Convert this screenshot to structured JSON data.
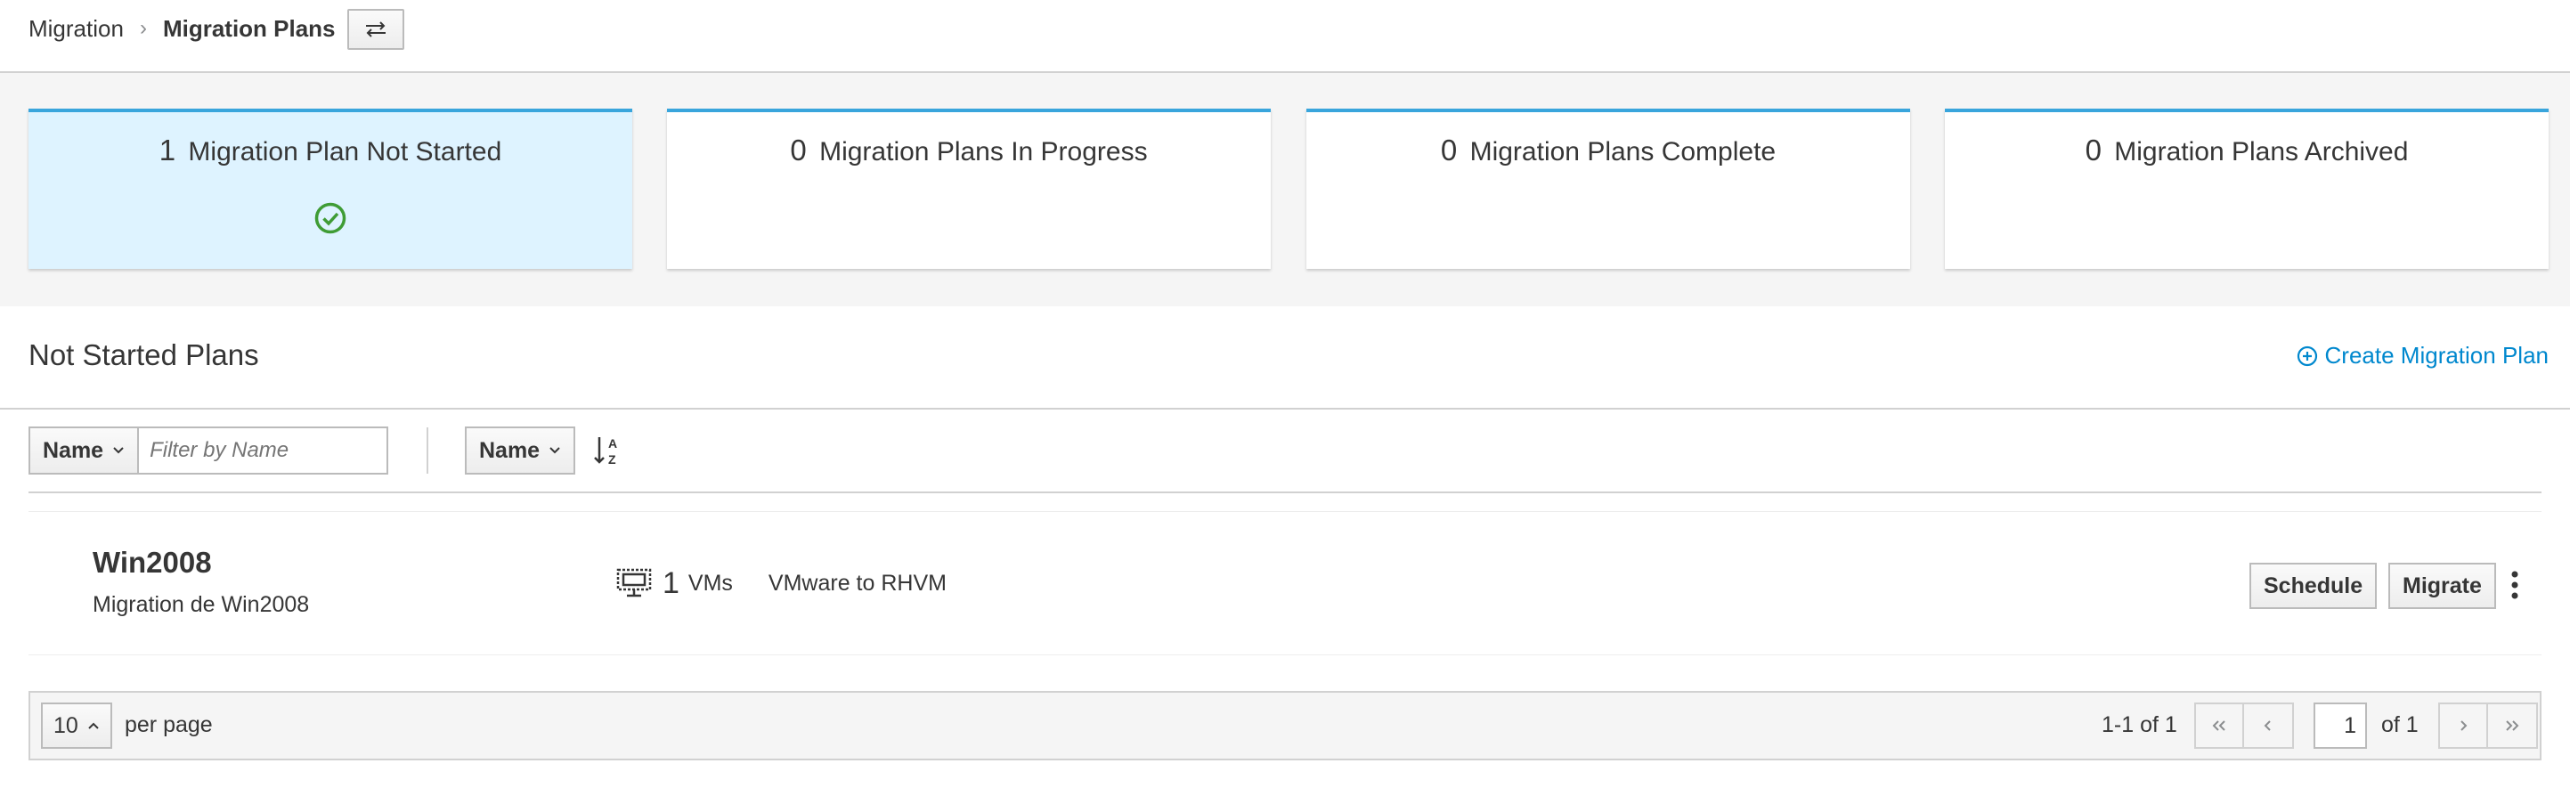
{
  "breadcrumb": {
    "parent": "Migration",
    "separator": "›",
    "current": "Migration Plans"
  },
  "cards": [
    {
      "count": "1",
      "label": "Migration Plan Not Started",
      "active": true,
      "icon": "check-circle-icon"
    },
    {
      "count": "0",
      "label": "Migration Plans In Progress",
      "active": false
    },
    {
      "count": "0",
      "label": "Migration Plans Complete",
      "active": false
    },
    {
      "count": "0",
      "label": "Migration Plans Archived",
      "active": false
    }
  ],
  "section": {
    "title": "Not Started Plans",
    "create_label": "Create Migration Plan"
  },
  "toolbar": {
    "filter_field": "Name",
    "filter_placeholder": "Filter by Name",
    "sort_field": "Name",
    "sort_icon": "sort-alpha-asc-icon"
  },
  "plans": [
    {
      "name": "Win2008",
      "description": "Migration de Win2008",
      "vm_count": "1",
      "vm_label": "VMs",
      "provider": "VMware to RHVM",
      "schedule_label": "Schedule",
      "migrate_label": "Migrate"
    }
  ],
  "pagination": {
    "per_page": "10",
    "per_page_label": "per page",
    "range": "1-1 of 1",
    "current_page": "1",
    "of_pages": "of 1"
  },
  "colors": {
    "accent_blue": "#39a5dc",
    "link_blue": "#0088ce",
    "active_card_bg": "#def3ff",
    "success_green": "#3f9c35"
  }
}
